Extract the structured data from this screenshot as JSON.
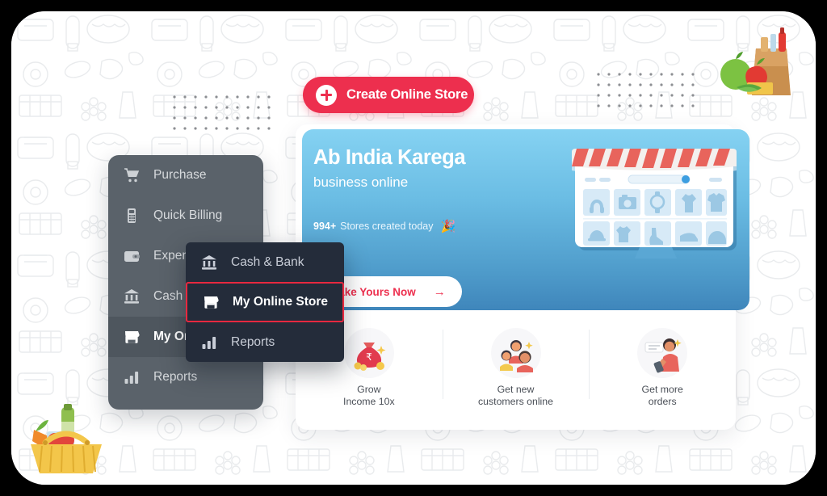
{
  "app": {
    "title": "Create Online Store promo screen"
  },
  "top_cta": {
    "label": "Create Online Store",
    "icon": "plus-circle-icon",
    "color": "#ed2f4e"
  },
  "hero": {
    "title": "Ab India Karega",
    "subtitle": "business online",
    "stat_count": "994+",
    "stat_text": "Stores created today",
    "stat_emoji": "🎉",
    "cta_label": "Make Yours Now",
    "cta_arrow": "→",
    "gradient_from": "#85d2f2",
    "gradient_to": "#3f86bb",
    "illustration": "online-storefront-illustration"
  },
  "features": [
    {
      "icon": "money-bag-icon",
      "caption": "Grow\nIncome 10x"
    },
    {
      "icon": "customers-group-icon",
      "caption": "Get new\ncustomers online"
    },
    {
      "icon": "person-phone-order-icon",
      "caption": "Get more\norders"
    }
  ],
  "sidebar": {
    "background": "#5a626a",
    "items": [
      {
        "icon": "shopping-cart-icon",
        "label": "Purchase",
        "active": false
      },
      {
        "icon": "pos-machine-icon",
        "label": "Quick Billing",
        "active": false
      },
      {
        "icon": "wallet-icon",
        "label": "Expenses",
        "active": false
      },
      {
        "icon": "bank-icon",
        "label": "Cash & Bank",
        "active": false
      },
      {
        "icon": "store-icon",
        "label": "My Online Store",
        "active": true
      },
      {
        "icon": "bar-chart-icon",
        "label": "Reports",
        "active": false
      }
    ]
  },
  "popup_menu": {
    "background": "#242c3a",
    "highlight_color": "#e8283f",
    "items": [
      {
        "icon": "bank-icon",
        "label": "Cash & Bank",
        "selected": false
      },
      {
        "icon": "store-icon",
        "label": "My Online Store",
        "selected": true
      },
      {
        "icon": "bar-chart-icon",
        "label": "Reports",
        "selected": false
      }
    ]
  },
  "decor": {
    "dot_grid_left": "dot-grid-pattern",
    "dot_grid_right": "dot-grid-pattern",
    "corner_top_right": "grocery-bag-illustration",
    "corner_bottom_left": "grocery-basket-illustration",
    "background_pattern": "grocery-doodle-pattern"
  }
}
